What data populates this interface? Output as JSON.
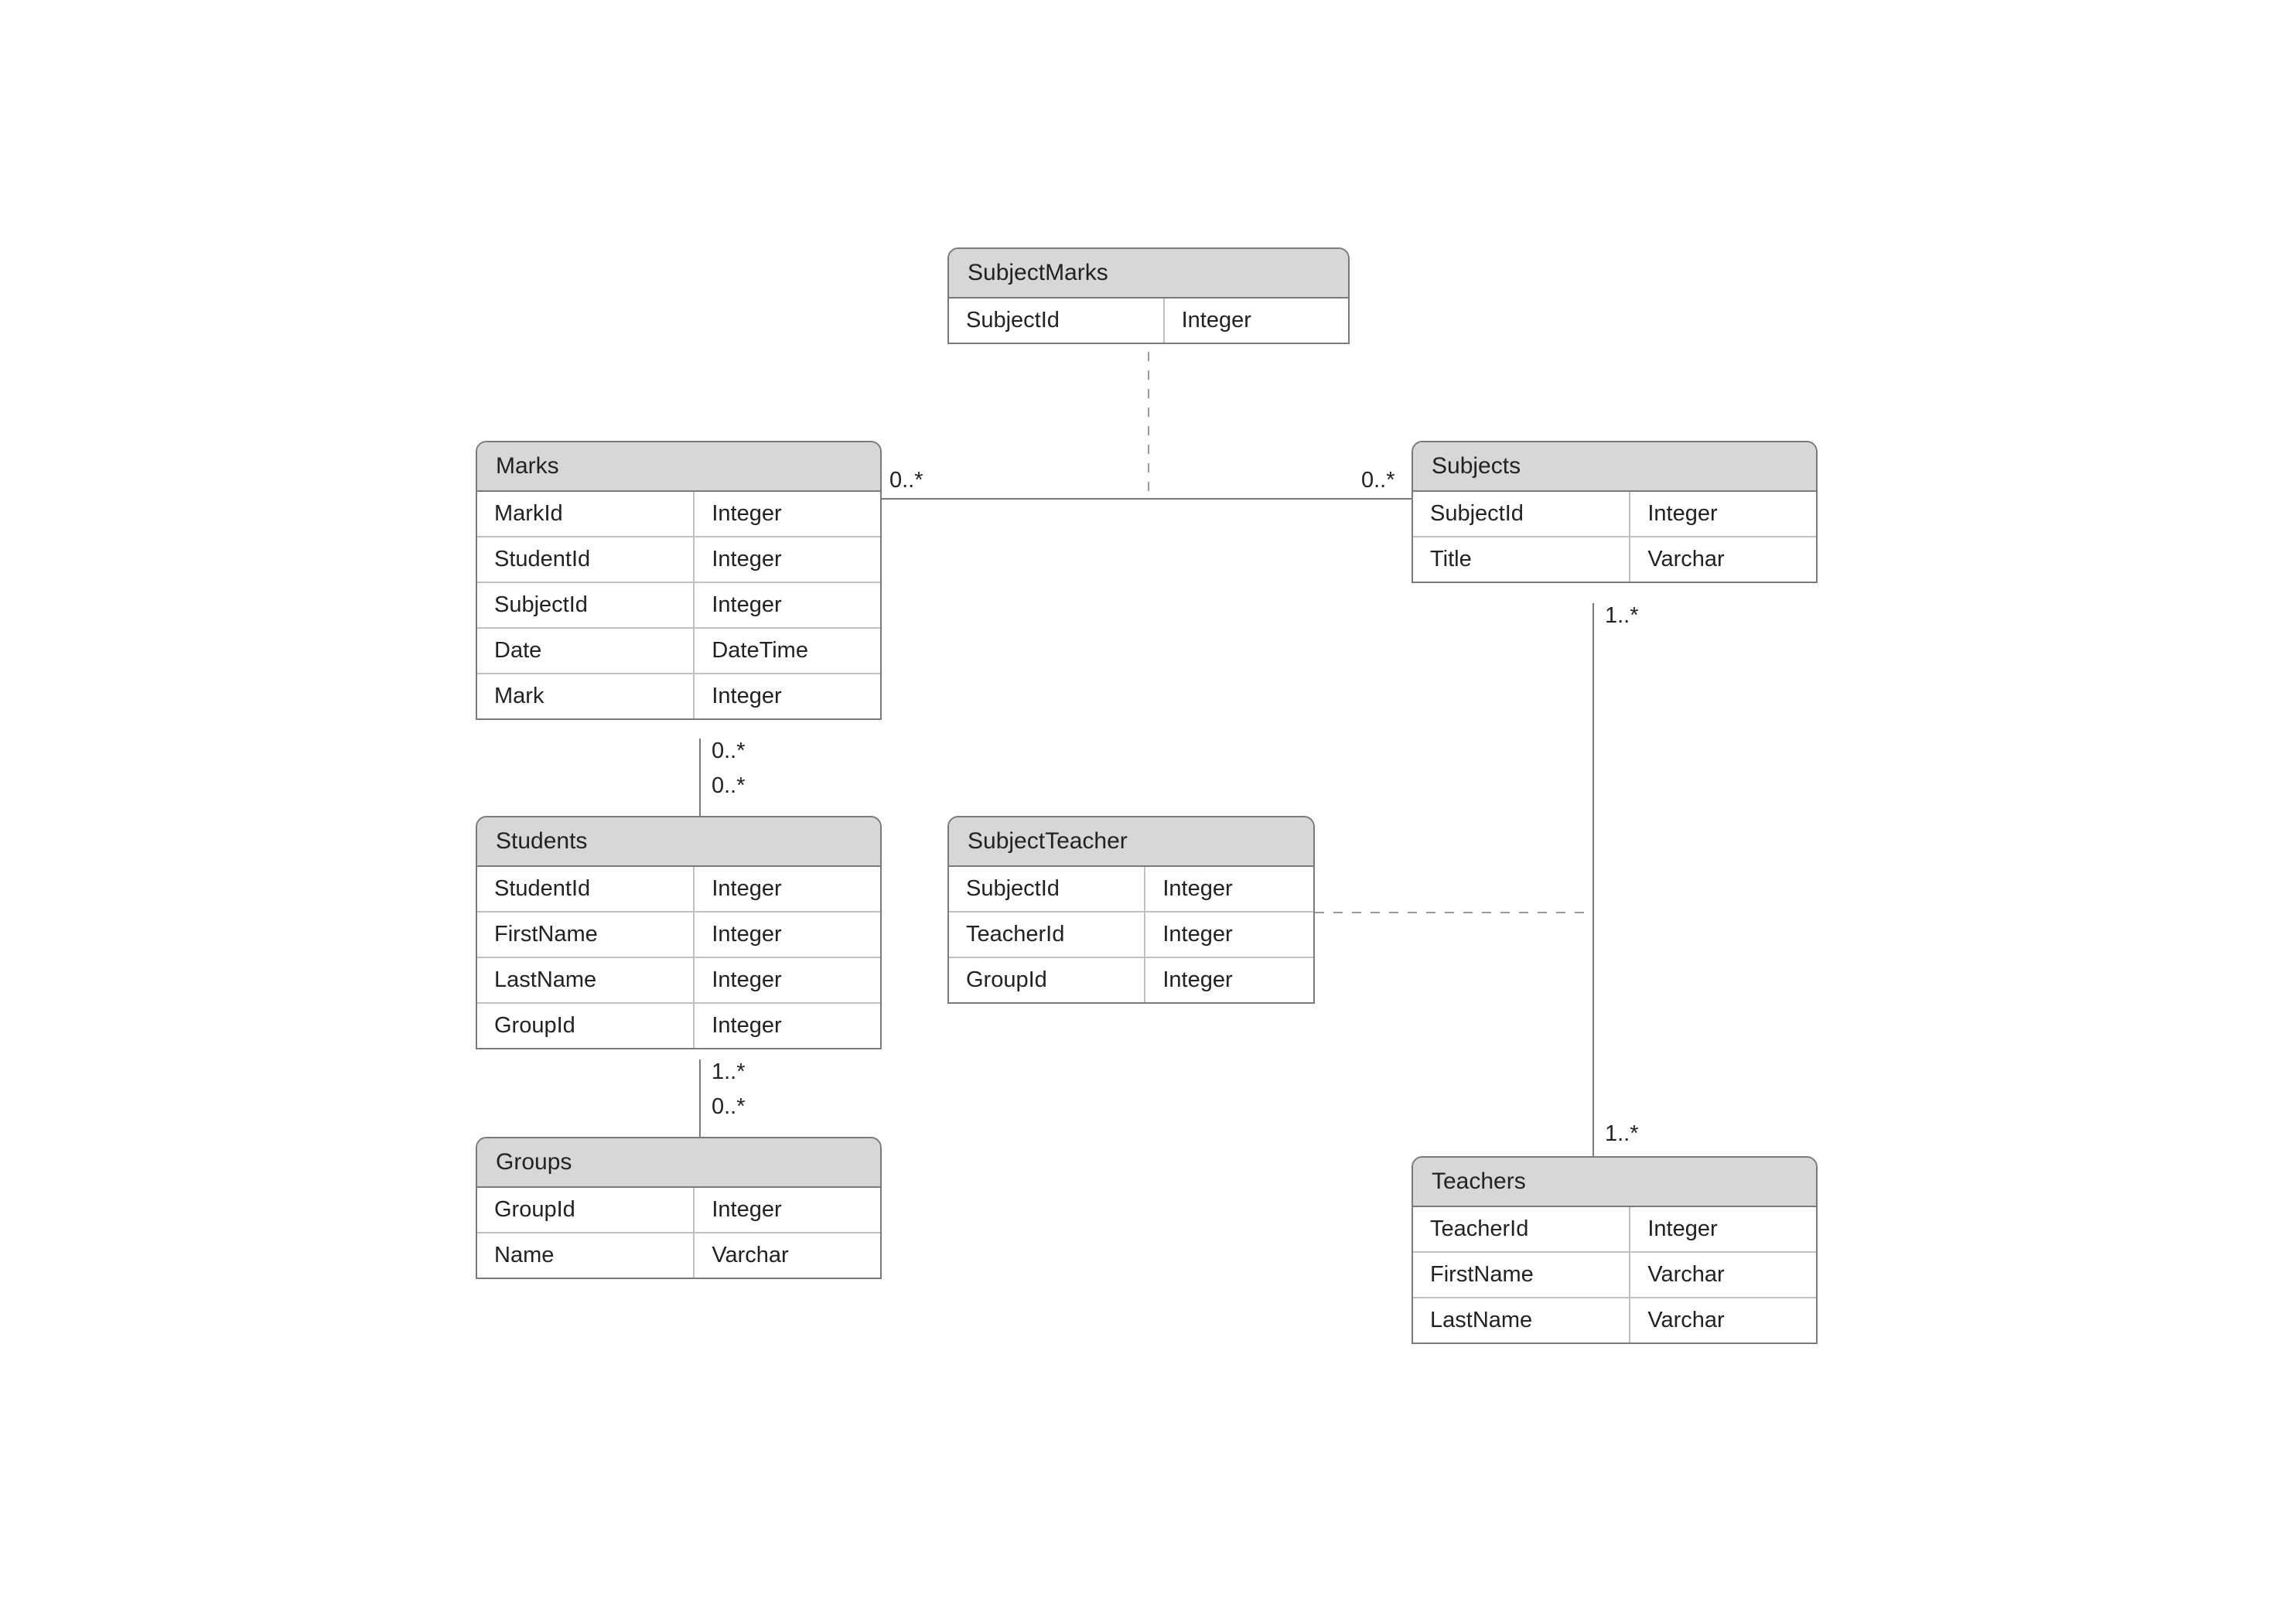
{
  "entities": {
    "subjectMarks": {
      "title": "SubjectMarks",
      "fields": [
        {
          "name": "SubjectId",
          "type": "Integer"
        }
      ]
    },
    "marks": {
      "title": "Marks",
      "fields": [
        {
          "name": "MarkId",
          "type": "Integer"
        },
        {
          "name": "StudentId",
          "type": "Integer"
        },
        {
          "name": "SubjectId",
          "type": "Integer"
        },
        {
          "name": "Date",
          "type": "DateTime"
        },
        {
          "name": "Mark",
          "type": "Integer"
        }
      ]
    },
    "subjects": {
      "title": "Subjects",
      "fields": [
        {
          "name": "SubjectId",
          "type": "Integer"
        },
        {
          "name": "Title",
          "type": "Varchar"
        }
      ]
    },
    "students": {
      "title": "Students",
      "fields": [
        {
          "name": "StudentId",
          "type": "Integer"
        },
        {
          "name": "FirstName",
          "type": "Integer"
        },
        {
          "name": "LastName",
          "type": "Integer"
        },
        {
          "name": "GroupId",
          "type": "Integer"
        }
      ]
    },
    "subjectTeacher": {
      "title": "SubjectTeacher",
      "fields": [
        {
          "name": "SubjectId",
          "type": "Integer"
        },
        {
          "name": "TeacherId",
          "type": "Integer"
        },
        {
          "name": "GroupId",
          "type": "Integer"
        }
      ]
    },
    "groups": {
      "title": "Groups",
      "fields": [
        {
          "name": "GroupId",
          "type": "Integer"
        },
        {
          "name": "Name",
          "type": "Varchar"
        }
      ]
    },
    "teachers": {
      "title": "Teachers",
      "fields": [
        {
          "name": "TeacherId",
          "type": "Integer"
        },
        {
          "name": "FirstName",
          "type": "Varchar"
        },
        {
          "name": "LastName",
          "type": "Varchar"
        }
      ]
    }
  },
  "labels": {
    "marksToSubjects_left": "0..*",
    "marksToSubjects_right": "0..*",
    "subjects_bottom": "1..*",
    "marks_bottom_a": "0..*",
    "marks_bottom_b": "0..*",
    "students_bottom_a": "1..*",
    "students_bottom_b": "0..*",
    "teachers_top": "1..*"
  }
}
